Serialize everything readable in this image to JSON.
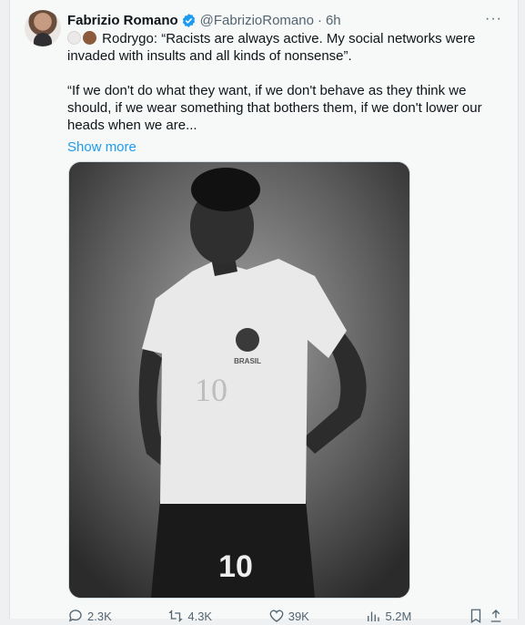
{
  "tweet": {
    "author_name": "Fabrizio Romano",
    "handle": "@FabrizioRomano",
    "separator": "·",
    "time": "6h",
    "more_glyph": "···",
    "text_line1": "Rodrygo: “Racists are always active. My social networks were invaded with insults and all kinds of nonsense”.",
    "text_line2": "“If we don't do what they want, if we don't behave as they think we should, if we wear something that bothers them, if we don't lower our heads when we are...",
    "show_more": "Show more",
    "jersey_text": "BRASIL",
    "shirt_number": "10",
    "shorts_number": "10"
  },
  "actions": {
    "replies": "2.3K",
    "reposts": "4.3K",
    "likes": "39K",
    "views": "5.2M"
  },
  "colors": {
    "link": "#1d9bf0",
    "secondary_text": "#536471",
    "verified": "#1d9bf0"
  }
}
